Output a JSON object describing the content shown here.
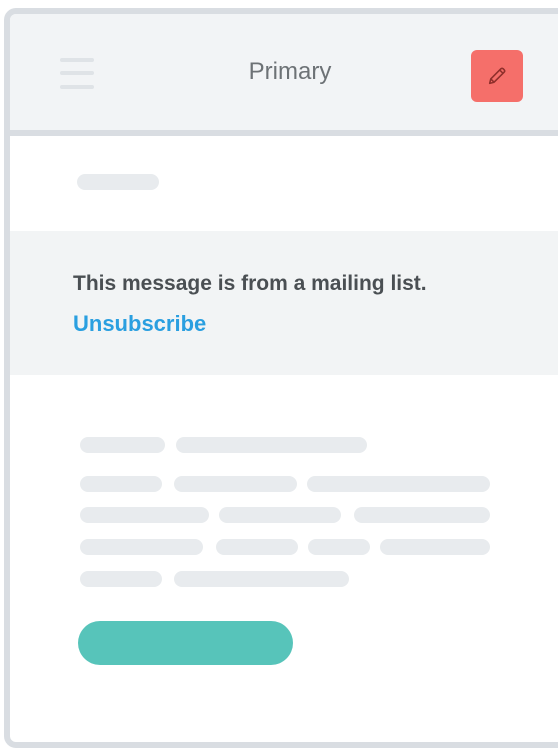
{
  "header": {
    "title": "Primary",
    "menu_icon": "hamburger-menu-icon",
    "compose_icon": "pencil-icon"
  },
  "notice": {
    "text": "This message is from a mailing list.",
    "link_label": "Unsubscribe"
  },
  "colors": {
    "header_bg": "#f2f4f6",
    "compose_accent": "#f56f6a",
    "link": "#2a9fe0",
    "cta": "#57c4ba",
    "placeholder": "#e8ebee"
  }
}
